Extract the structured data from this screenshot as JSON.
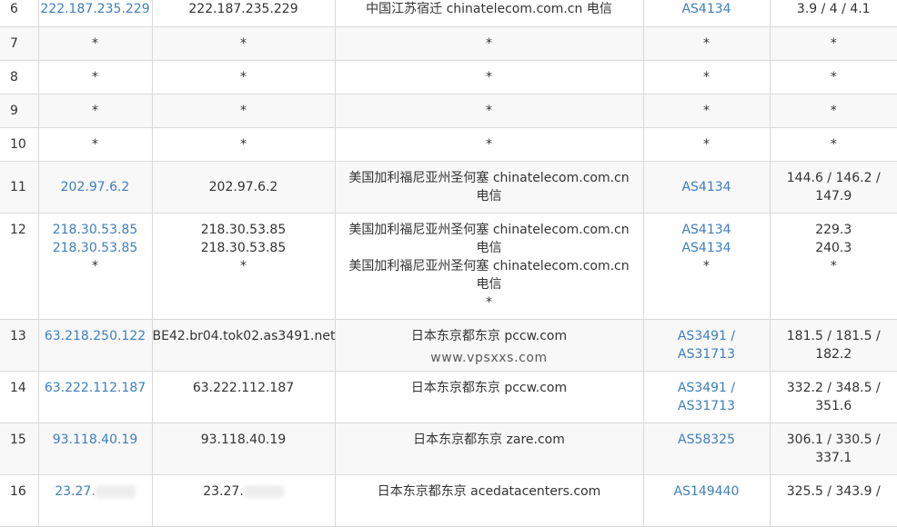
{
  "rows": [
    {
      "no": "6",
      "ip": [
        "222.187.235.229"
      ],
      "host": [
        "222.187.235.229"
      ],
      "loc": [
        "中国江苏宿迁 chinatelecom.com.cn 电信"
      ],
      "as": [
        "AS4134"
      ],
      "time": "3.9 / 4 / 4.1"
    },
    {
      "no": "7",
      "ip": [
        "*"
      ],
      "host": [
        "*"
      ],
      "loc": [
        "*"
      ],
      "as": [
        "*"
      ],
      "time": "*"
    },
    {
      "no": "8",
      "ip": [
        "*"
      ],
      "host": [
        "*"
      ],
      "loc": [
        "*"
      ],
      "as": [
        "*"
      ],
      "time": "*"
    },
    {
      "no": "9",
      "ip": [
        "*"
      ],
      "host": [
        "*"
      ],
      "loc": [
        "*"
      ],
      "as": [
        "*"
      ],
      "time": "*"
    },
    {
      "no": "10",
      "ip": [
        "*"
      ],
      "host": [
        "*"
      ],
      "loc": [
        "*"
      ],
      "as": [
        "*"
      ],
      "time": "*"
    },
    {
      "no": "11",
      "ip": [
        "202.97.6.2"
      ],
      "host": [
        "202.97.6.2"
      ],
      "loc": [
        "美国加利福尼亚州圣何塞 chinatelecom.com.cn 电信"
      ],
      "as": [
        "AS4134"
      ],
      "time": "144.6 / 146.2 / 147.9"
    },
    {
      "no": "12",
      "ip": [
        "218.30.53.85",
        "218.30.53.85",
        "*"
      ],
      "host": [
        "218.30.53.85",
        "218.30.53.85",
        "*"
      ],
      "loc": [
        "美国加利福尼亚州圣何塞 chinatelecom.com.cn 电信",
        "美国加利福尼亚州圣何塞 chinatelecom.com.cn 电信",
        "*"
      ],
      "as": [
        "AS4134",
        "AS4134",
        "*"
      ],
      "time": "229.3\n240.3\n*"
    },
    {
      "no": "13",
      "ip": [
        "63.218.250.122"
      ],
      "host": [
        "BE42.br04.tok02.as3491.net"
      ],
      "loc": [
        "日本东京都东京 pccw.com"
      ],
      "as": [
        "AS3491 /",
        "AS31713"
      ],
      "time": "181.5 / 181.5 / 182.2",
      "watermark": "www.vpsxxs.com"
    },
    {
      "no": "14",
      "ip": [
        "63.222.112.187"
      ],
      "host": [
        "63.222.112.187"
      ],
      "loc": [
        "日本东京都东京 pccw.com"
      ],
      "as": [
        "AS3491 /",
        "AS31713"
      ],
      "time": "332.2 / 348.5 / 351.6"
    },
    {
      "no": "15",
      "ip": [
        "93.118.40.19"
      ],
      "host": [
        "93.118.40.19"
      ],
      "loc": [
        "日本东京都东京 zare.com"
      ],
      "as": [
        "AS58325"
      ],
      "time": "306.1 / 330.5 / 337.1"
    },
    {
      "no": "16",
      "ip": [
        "23.27."
      ],
      "host": [
        "23.27."
      ],
      "loc": [
        "日本东京都东京 acedatacenters.com"
      ],
      "as": [
        "AS149440"
      ],
      "time": "325.5 / 343.9 /"
    }
  ]
}
